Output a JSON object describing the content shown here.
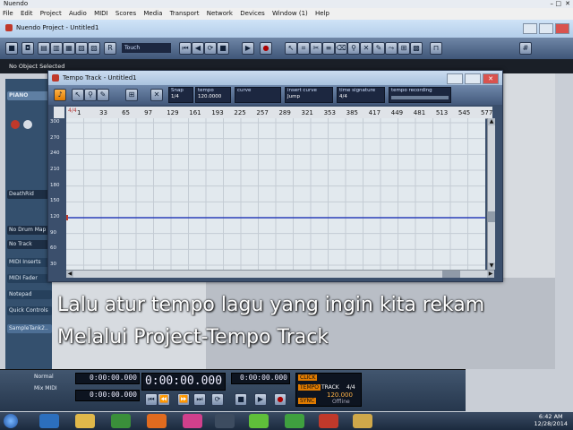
{
  "os_window": {
    "title": "Nuendo"
  },
  "menubar": {
    "items": [
      "File",
      "Edit",
      "Project",
      "Audio",
      "MIDI",
      "Scores",
      "Media",
      "Transport",
      "Network",
      "Devices",
      "Window (1)",
      "Help"
    ]
  },
  "project": {
    "title": "Nuendo Project - Untitled1",
    "automation_mode": "Touch"
  },
  "infoline": {
    "text": "No Object Selected"
  },
  "inspector": {
    "track_name": "PIANO",
    "items": [
      "MIDI Inserts",
      "MIDI Fader",
      "Notepad",
      "Quick Controls",
      "SampleTank2.."
    ],
    "labels": [
      "DeathRid",
      "No Drum Map",
      "No Track"
    ]
  },
  "tempo_window": {
    "title": "Tempo Track - Untitled1",
    "fields": [
      {
        "label": "Snap",
        "value": "1/4"
      },
      {
        "label": "tempo",
        "value": "120.0000"
      },
      {
        "label": "curve",
        "value": ""
      },
      {
        "label": "insert curve",
        "value": "Jump"
      },
      {
        "label": "time signature",
        "value": "4/4"
      },
      {
        "label": "tempo recording",
        "value": ""
      }
    ],
    "ruler_numbers": [
      "1",
      "33",
      "65",
      "97",
      "129",
      "161",
      "193",
      "225",
      "257",
      "289",
      "321",
      "353",
      "385",
      "417",
      "449",
      "481",
      "513",
      "545",
      "577"
    ],
    "ruler_marker": "4/4"
  },
  "chart_data": {
    "type": "line",
    "title": "",
    "xlabel": "",
    "ylabel": "",
    "ylim": [
      30,
      300
    ],
    "yticks": [
      300,
      270,
      240,
      210,
      180,
      150,
      120,
      90,
      60,
      30
    ],
    "series": [
      {
        "x": [
          1,
          577
        ],
        "y": [
          120,
          120
        ]
      }
    ],
    "line_color": "#2a3fb8",
    "grid": true
  },
  "caption": {
    "line1": "Lalu atur tempo lagu yang ingin kita rekam",
    "line2": "Melalui Project-Tempo Track"
  },
  "transport": {
    "time_left_1": "0:00:00.000",
    "time_left_2": "0:00:00.000",
    "time_main": "0:00:00.000",
    "time_right": "0:00:00.000",
    "mode": "Normal",
    "quantize": "Mix MIDI",
    "click": "CLICK",
    "tempo_label": "TEMPO",
    "track": "TRACK",
    "sig": "4/4",
    "tempo_value": "120.000",
    "sync": "SYNC",
    "offline": "Offline"
  },
  "taskbar": {
    "time": "6:42 AM",
    "date": "12/28/2014"
  }
}
